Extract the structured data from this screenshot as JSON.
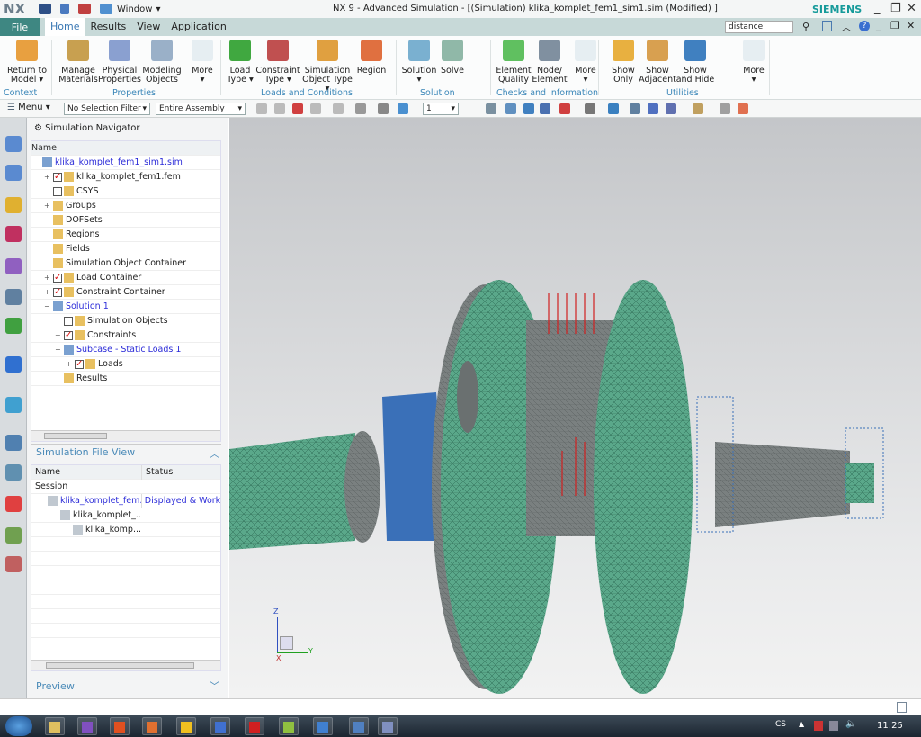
{
  "titlebar": {
    "logo": "NX",
    "window_menu": "Window",
    "title": "NX 9 - Advanced Simulation - [(Simulation) klika_komplet_fem1_sim1.sim (Modified) ]",
    "brand": "SIEMENS"
  },
  "tabs": {
    "file": "File",
    "items": [
      "Home",
      "Results",
      "View",
      "Application"
    ],
    "active": "Home",
    "search_value": "distance"
  },
  "ribbon": {
    "buttons": [
      {
        "label1": "Return to",
        "label2": "Model ▾",
        "icon": "return-to-model-icon",
        "color": "#e8a040"
      },
      {
        "label1": "Manage",
        "label2": "Materials",
        "icon": "manage-materials-icon",
        "color": "#c8a050"
      },
      {
        "label1": "Physical",
        "label2": "Properties",
        "icon": "physical-properties-icon",
        "color": "#8aa0d0"
      },
      {
        "label1": "Modeling",
        "label2": "Objects",
        "icon": "modeling-objects-icon",
        "color": "#9ab0c8"
      },
      {
        "label1": "More",
        "label2": "▾",
        "icon": "more-icon",
        "color": "#e6eef2"
      },
      {
        "label1": "Load",
        "label2": "Type ▾",
        "icon": "load-type-icon",
        "color": "#40a840"
      },
      {
        "label1": "Constraint",
        "label2": "Type ▾",
        "icon": "constraint-type-icon",
        "color": "#c05050"
      },
      {
        "label1": "Simulation",
        "label2": "Object Type ▾",
        "icon": "simulation-object-type-icon",
        "color": "#e0a040"
      },
      {
        "label1": "Region",
        "label2": "",
        "icon": "region-icon",
        "color": "#e07040"
      },
      {
        "label1": "Solution",
        "label2": "▾",
        "icon": "solution-icon",
        "color": "#7ab0d0"
      },
      {
        "label1": "Solve",
        "label2": "",
        "icon": "solve-icon",
        "color": "#90b8a8"
      },
      {
        "label1": "Element",
        "label2": "Quality",
        "icon": "element-quality-icon",
        "color": "#60c060"
      },
      {
        "label1": "Node/",
        "label2": "Element",
        "icon": "node-element-icon",
        "color": "#8090a0"
      },
      {
        "label1": "More",
        "label2": "▾",
        "icon": "more-icon",
        "color": "#e6eef2"
      },
      {
        "label1": "Show",
        "label2": "Only",
        "icon": "show-only-icon",
        "color": "#e8b040"
      },
      {
        "label1": "Show",
        "label2": "Adjacent",
        "icon": "show-adjacent-icon",
        "color": "#d8a050"
      },
      {
        "label1": "Show",
        "label2": "and Hide",
        "icon": "show-and-hide-icon",
        "color": "#4080c0"
      },
      {
        "label1": "More",
        "label2": "▾",
        "icon": "more-icon",
        "color": "#e6eef2"
      }
    ],
    "groups": [
      "Context",
      "Properties",
      "Loads and Conditions",
      "Solution",
      "Checks and Information",
      "Utilities"
    ]
  },
  "toolbar": {
    "menu": "Menu ▾",
    "selection_filter": "No Selection Filter",
    "assembly_scope": "Entire Assembly",
    "layer": "1"
  },
  "navigator": {
    "title": "Simulation Navigator",
    "column": "Name",
    "items": [
      {
        "label": "klika_komplet_fem1_sim1.sim",
        "depth": 0,
        "blue": true,
        "check": null,
        "exp": ""
      },
      {
        "label": "klika_komplet_fem1.fem",
        "depth": 1,
        "check": true,
        "exp": "+"
      },
      {
        "label": "CSYS",
        "depth": 1,
        "check": false,
        "exp": ""
      },
      {
        "label": "Groups",
        "depth": 1,
        "check": null,
        "exp": "+"
      },
      {
        "label": "DOFSets",
        "depth": 1,
        "check": null,
        "exp": ""
      },
      {
        "label": "Regions",
        "depth": 1,
        "check": null,
        "exp": ""
      },
      {
        "label": "Fields",
        "depth": 1,
        "check": null,
        "exp": ""
      },
      {
        "label": "Simulation Object Container",
        "depth": 1,
        "check": null,
        "exp": ""
      },
      {
        "label": "Load Container",
        "depth": 1,
        "check": true,
        "exp": "+"
      },
      {
        "label": "Constraint Container",
        "depth": 1,
        "check": true,
        "exp": "+"
      },
      {
        "label": "Solution 1",
        "depth": 1,
        "blue": true,
        "check": null,
        "exp": "−"
      },
      {
        "label": "Simulation Objects",
        "depth": 2,
        "check": false,
        "exp": ""
      },
      {
        "label": "Constraints",
        "depth": 2,
        "check": true,
        "exp": "+"
      },
      {
        "label": "Subcase - Static Loads 1",
        "depth": 2,
        "blue": true,
        "check": null,
        "exp": "−"
      },
      {
        "label": "Loads",
        "depth": 3,
        "check": true,
        "exp": "+"
      },
      {
        "label": "Results",
        "depth": 2,
        "check": null,
        "exp": ""
      }
    ]
  },
  "file_view": {
    "title": "Simulation File View",
    "columns": [
      "Name",
      "Status"
    ],
    "rows": [
      {
        "name": "Session",
        "status": "",
        "depth": 0
      },
      {
        "name": "klika_komplet_fem...",
        "status": "Displayed & Work",
        "depth": 1
      },
      {
        "name": "klika_komplet_...",
        "status": "",
        "depth": 2
      },
      {
        "name": "klika_komp...",
        "status": "",
        "depth": 3
      }
    ]
  },
  "preview": {
    "title": "Preview"
  },
  "viewport": {
    "triad": {
      "x": "X",
      "y": "Y",
      "z": "Z"
    },
    "mesh_color": "#5aa88a",
    "fixed_color": "#3a70b8",
    "load_color": "#d02020"
  },
  "taskbar": {
    "language": "CS",
    "time": "11:25"
  }
}
